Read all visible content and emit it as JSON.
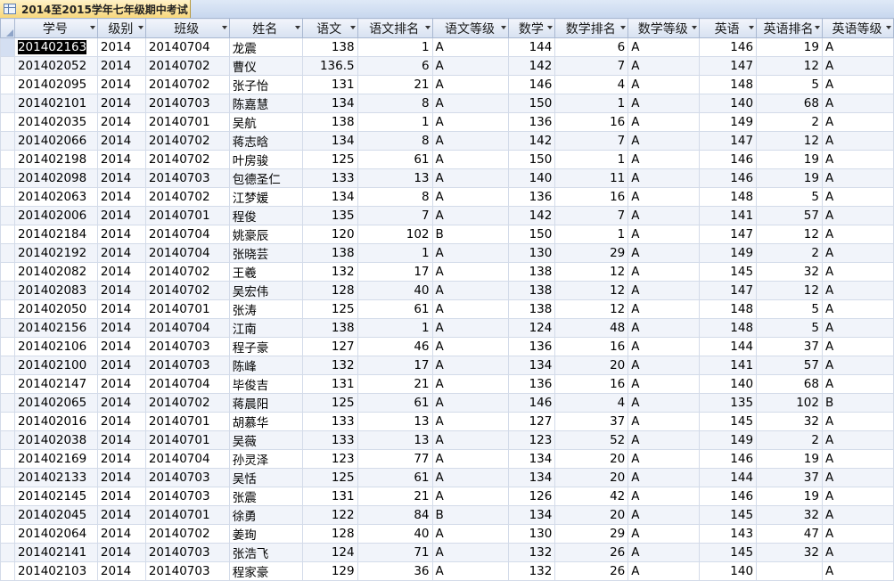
{
  "tab": {
    "title": "2014至2015学年七年级期中考试"
  },
  "columns": [
    {
      "key": "id",
      "label": "学号",
      "align": "txt"
    },
    {
      "key": "grade",
      "label": "级别",
      "align": "txt"
    },
    {
      "key": "cls",
      "label": "班级",
      "align": "txt"
    },
    {
      "key": "name",
      "label": "姓名",
      "align": "txt"
    },
    {
      "key": "chn",
      "label": "语文",
      "align": "num"
    },
    {
      "key": "chn_rank",
      "label": "语文排名",
      "align": "num"
    },
    {
      "key": "chn_lvl",
      "label": "语文等级",
      "align": "txt"
    },
    {
      "key": "math",
      "label": "数学",
      "align": "num"
    },
    {
      "key": "math_rank",
      "label": "数学排名",
      "align": "num"
    },
    {
      "key": "math_lvl",
      "label": "数学等级",
      "align": "txt"
    },
    {
      "key": "eng",
      "label": "英语",
      "align": "num"
    },
    {
      "key": "eng_rank",
      "label": "英语排名",
      "align": "num"
    },
    {
      "key": "eng_lvl",
      "label": "英语等级",
      "align": "txt"
    }
  ],
  "rows": [
    [
      "201402163",
      "2014",
      "20140704",
      "龙震",
      "138",
      "1",
      "A",
      "144",
      "6",
      "A",
      "146",
      "19",
      "A"
    ],
    [
      "201402052",
      "2014",
      "20140702",
      "曹仪",
      "136.5",
      "6",
      "A",
      "142",
      "7",
      "A",
      "147",
      "12",
      "A"
    ],
    [
      "201402095",
      "2014",
      "20140702",
      "张子怡",
      "131",
      "21",
      "A",
      "146",
      "4",
      "A",
      "148",
      "5",
      "A"
    ],
    [
      "201402101",
      "2014",
      "20140703",
      "陈嘉慧",
      "134",
      "8",
      "A",
      "150",
      "1",
      "A",
      "140",
      "68",
      "A"
    ],
    [
      "201402035",
      "2014",
      "20140701",
      "吴航",
      "138",
      "1",
      "A",
      "136",
      "16",
      "A",
      "149",
      "2",
      "A"
    ],
    [
      "201402066",
      "2014",
      "20140702",
      "蒋志晗",
      "134",
      "8",
      "A",
      "142",
      "7",
      "A",
      "147",
      "12",
      "A"
    ],
    [
      "201402198",
      "2014",
      "20140702",
      "叶房骏",
      "125",
      "61",
      "A",
      "150",
      "1",
      "A",
      "146",
      "19",
      "A"
    ],
    [
      "201402098",
      "2014",
      "20140703",
      "包德圣仁",
      "133",
      "13",
      "A",
      "140",
      "11",
      "A",
      "146",
      "19",
      "A"
    ],
    [
      "201402063",
      "2014",
      "20140702",
      "江梦媛",
      "134",
      "8",
      "A",
      "136",
      "16",
      "A",
      "148",
      "5",
      "A"
    ],
    [
      "201402006",
      "2014",
      "20140701",
      "程俊",
      "135",
      "7",
      "A",
      "142",
      "7",
      "A",
      "141",
      "57",
      "A"
    ],
    [
      "201402184",
      "2014",
      "20140704",
      "姚豪辰",
      "120",
      "102",
      "B",
      "150",
      "1",
      "A",
      "147",
      "12",
      "A"
    ],
    [
      "201402192",
      "2014",
      "20140704",
      "张晓芸",
      "138",
      "1",
      "A",
      "130",
      "29",
      "A",
      "149",
      "2",
      "A"
    ],
    [
      "201402082",
      "2014",
      "20140702",
      "王羲",
      "132",
      "17",
      "A",
      "138",
      "12",
      "A",
      "145",
      "32",
      "A"
    ],
    [
      "201402083",
      "2014",
      "20140702",
      "吴宏伟",
      "128",
      "40",
      "A",
      "138",
      "12",
      "A",
      "147",
      "12",
      "A"
    ],
    [
      "201402050",
      "2014",
      "20140701",
      "张涛",
      "125",
      "61",
      "A",
      "138",
      "12",
      "A",
      "148",
      "5",
      "A"
    ],
    [
      "201402156",
      "2014",
      "20140704",
      "江南",
      "138",
      "1",
      "A",
      "124",
      "48",
      "A",
      "148",
      "5",
      "A"
    ],
    [
      "201402106",
      "2014",
      "20140703",
      "程子豪",
      "127",
      "46",
      "A",
      "136",
      "16",
      "A",
      "144",
      "37",
      "A"
    ],
    [
      "201402100",
      "2014",
      "20140703",
      "陈峰",
      "132",
      "17",
      "A",
      "134",
      "20",
      "A",
      "141",
      "57",
      "A"
    ],
    [
      "201402147",
      "2014",
      "20140704",
      "毕俊吉",
      "131",
      "21",
      "A",
      "136",
      "16",
      "A",
      "140",
      "68",
      "A"
    ],
    [
      "201402065",
      "2014",
      "20140702",
      "蒋晨阳",
      "125",
      "61",
      "A",
      "146",
      "4",
      "A",
      "135",
      "102",
      "B"
    ],
    [
      "201402016",
      "2014",
      "20140701",
      "胡慕华",
      "133",
      "13",
      "A",
      "127",
      "37",
      "A",
      "145",
      "32",
      "A"
    ],
    [
      "201402038",
      "2014",
      "20140701",
      "吴薇",
      "133",
      "13",
      "A",
      "123",
      "52",
      "A",
      "149",
      "2",
      "A"
    ],
    [
      "201402169",
      "2014",
      "20140704",
      "孙灵泽",
      "123",
      "77",
      "A",
      "134",
      "20",
      "A",
      "146",
      "19",
      "A"
    ],
    [
      "201402133",
      "2014",
      "20140703",
      "吴恬",
      "125",
      "61",
      "A",
      "134",
      "20",
      "A",
      "144",
      "37",
      "A"
    ],
    [
      "201402145",
      "2014",
      "20140703",
      "张震",
      "131",
      "21",
      "A",
      "126",
      "42",
      "A",
      "146",
      "19",
      "A"
    ],
    [
      "201402045",
      "2014",
      "20140701",
      "徐勇",
      "122",
      "84",
      "B",
      "134",
      "20",
      "A",
      "145",
      "32",
      "A"
    ],
    [
      "201402064",
      "2014",
      "20140702",
      "姜珣",
      "128",
      "40",
      "A",
      "130",
      "29",
      "A",
      "143",
      "47",
      "A"
    ],
    [
      "201402141",
      "2014",
      "20140703",
      "张浩飞",
      "124",
      "71",
      "A",
      "132",
      "26",
      "A",
      "145",
      "32",
      "A"
    ],
    [
      "201402103",
      "2014",
      "20140703",
      "程家豪",
      "129",
      "36",
      "A",
      "132",
      "26",
      "A",
      "140",
      "",
      "A"
    ]
  ]
}
